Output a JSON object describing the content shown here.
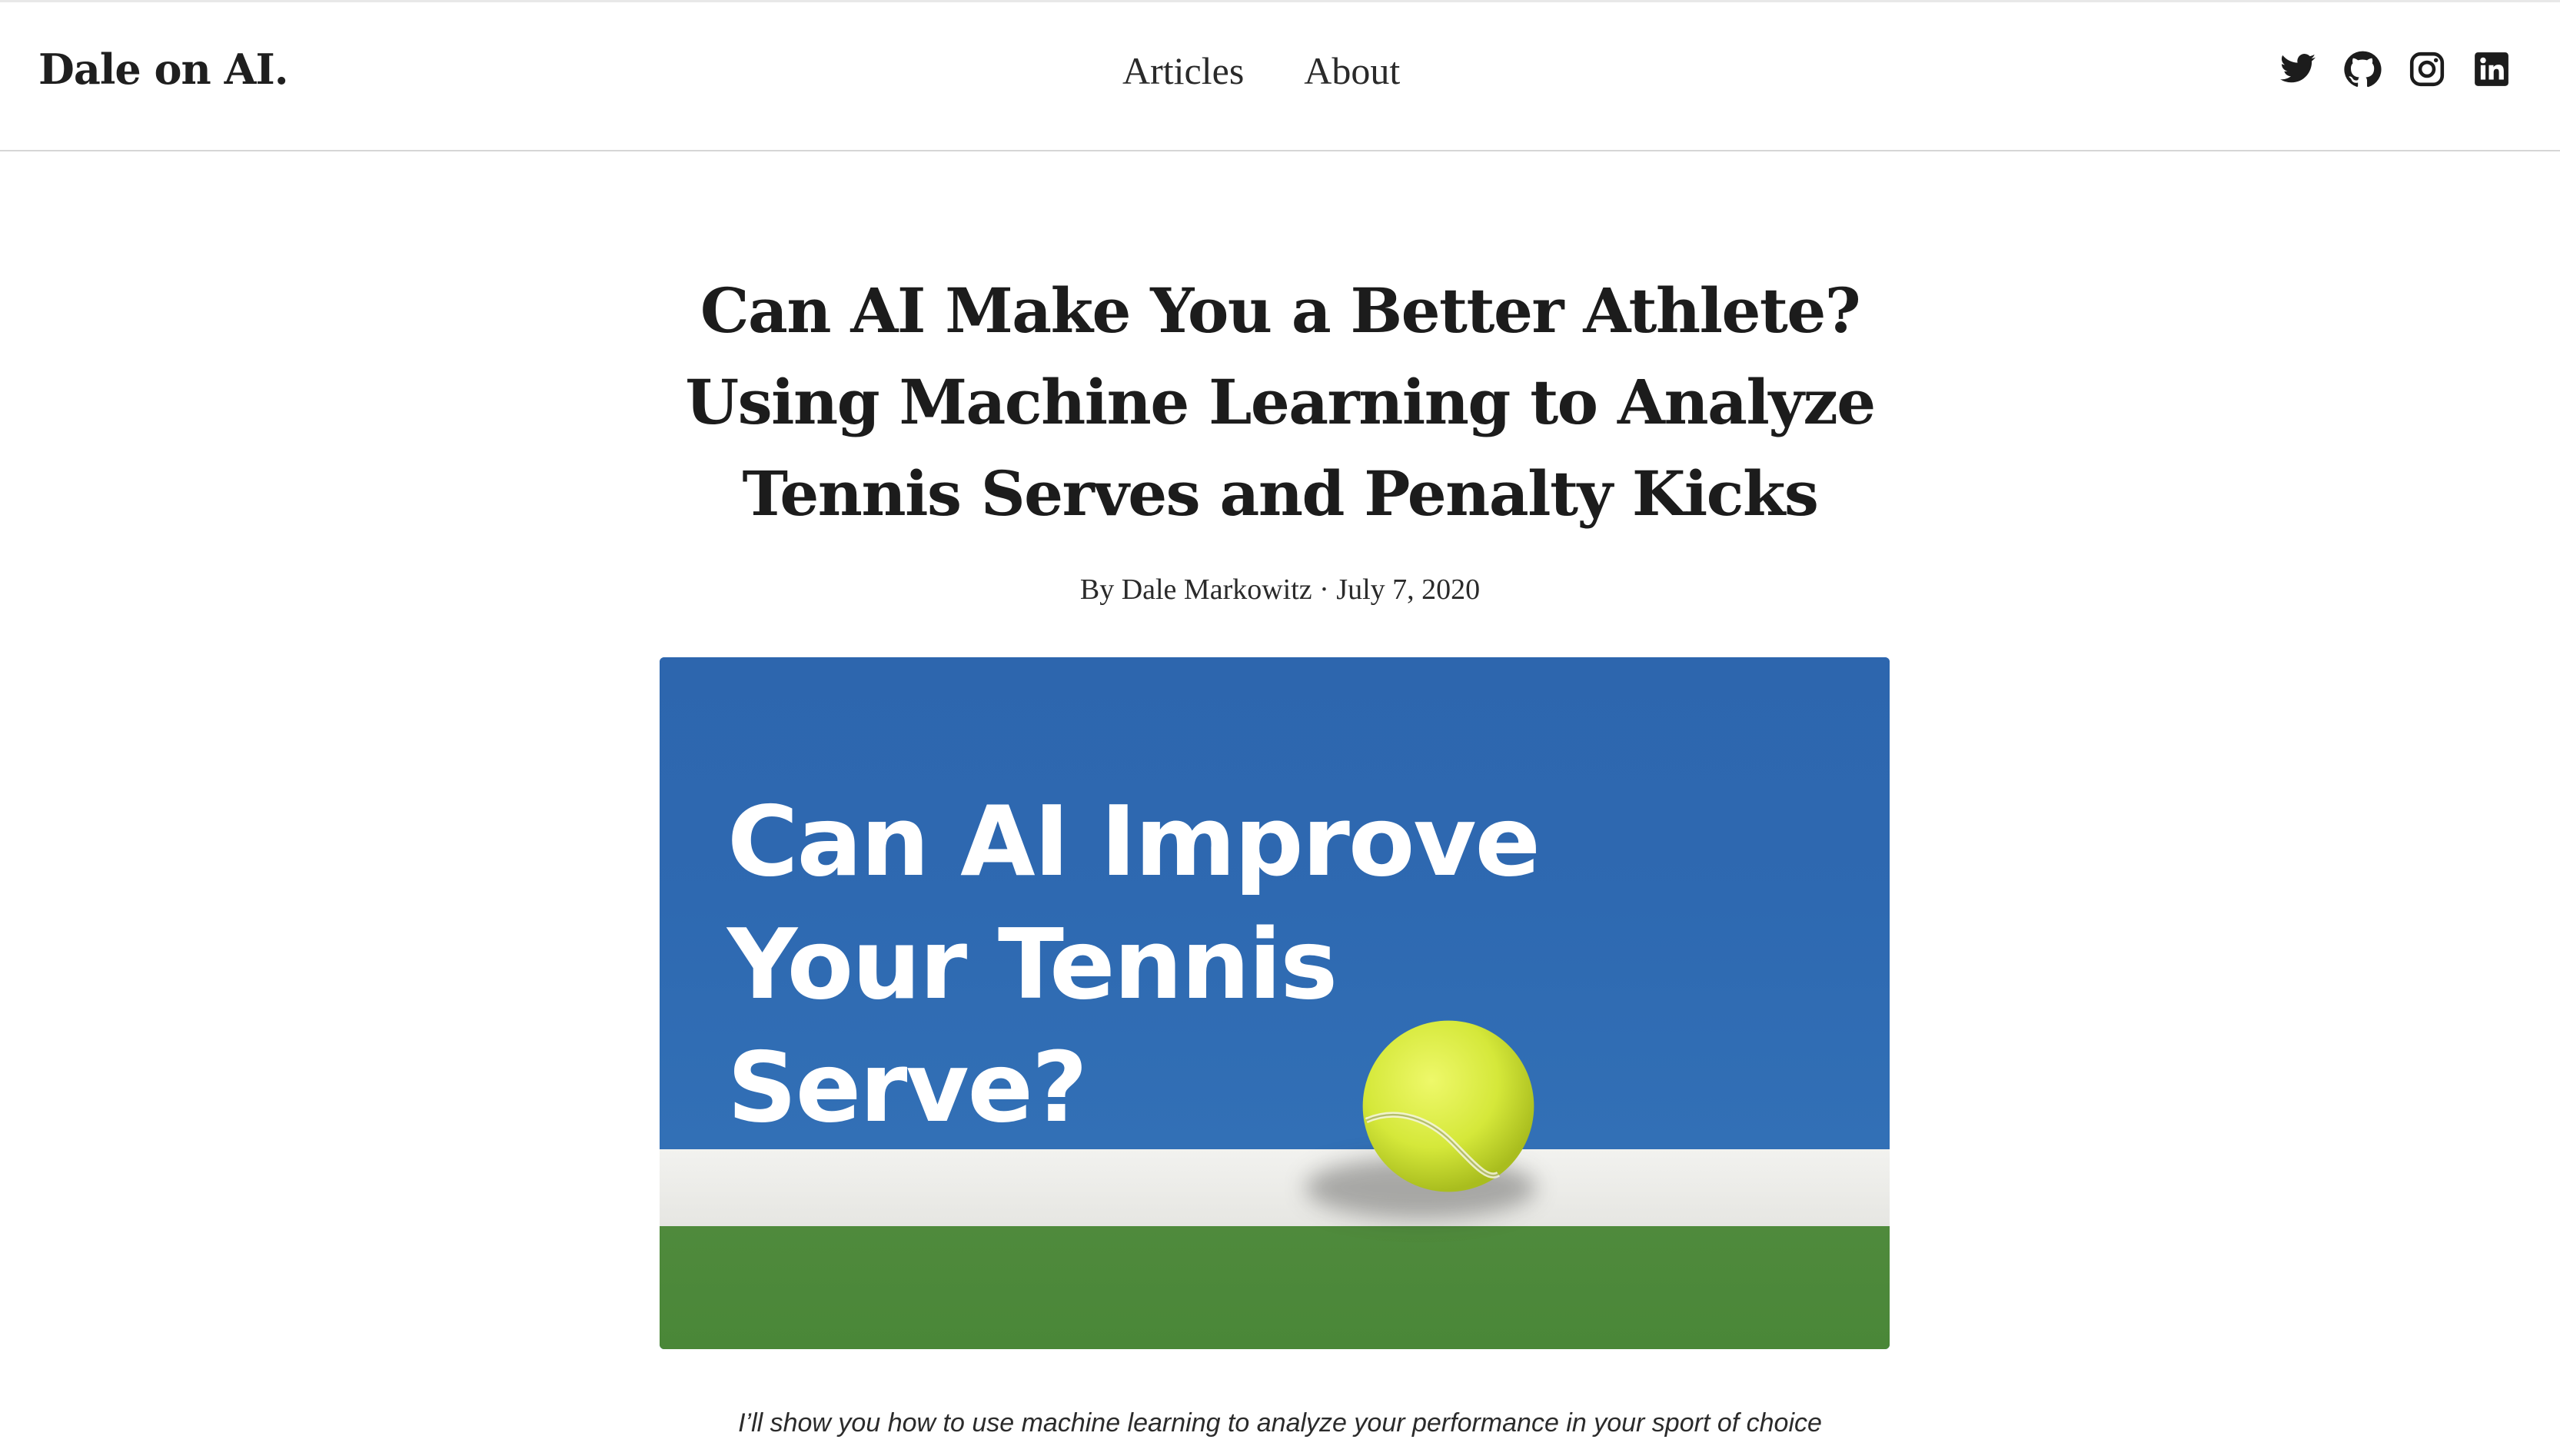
{
  "header": {
    "brand": "Dale on AI.",
    "nav": [
      "Articles",
      "About"
    ],
    "social_icons": [
      "twitter-icon",
      "github-icon",
      "instagram-icon",
      "linkedin-icon"
    ]
  },
  "article": {
    "title_lines": [
      "Can AI Make You a Better Athlete?",
      "Using Machine Learning to Analyze",
      "Tennis Serves and Penalty Kicks"
    ],
    "byline": "By Dale Markowitz · July 7, 2020",
    "hero": {
      "text_lines": [
        "Can AI Improve",
        "Your Tennis",
        "Serve?"
      ],
      "colors": {
        "court": "#2e69b1",
        "line": "#eeeeea",
        "grass": "#4c8839",
        "ball": "#d9ec3a"
      }
    },
    "lede": "I’ll show you how to use machine learning to analyze your performance in your sport of choice"
  }
}
